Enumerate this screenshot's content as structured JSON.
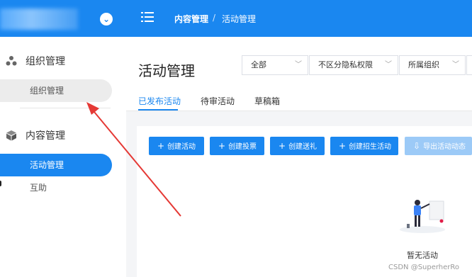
{
  "header": {
    "breadcrumb_main": "内容管理",
    "breadcrumb_sep": "/",
    "breadcrumb_current": "活动管理"
  },
  "sidebar": {
    "group1": {
      "title": "组织管理",
      "items": [
        "组织管理"
      ]
    },
    "group2": {
      "title": "内容管理",
      "items": [
        "活动管理",
        "互助"
      ]
    }
  },
  "main": {
    "title": "活动管理",
    "filters": [
      "全部",
      "不区分隐私权限",
      "所属组织"
    ],
    "tabs": [
      "已发布活动",
      "待审活动",
      "草稿箱"
    ],
    "buttons": [
      "创建活动",
      "创建投票",
      "创建送礼",
      "创建招生活动",
      "导出活动动态"
    ],
    "empty_text": "暂无活动"
  },
  "watermark": "CSDN @SuperherRo",
  "colors": {
    "primary": "#1a87f0",
    "annotation_arrow": "#e53935"
  }
}
